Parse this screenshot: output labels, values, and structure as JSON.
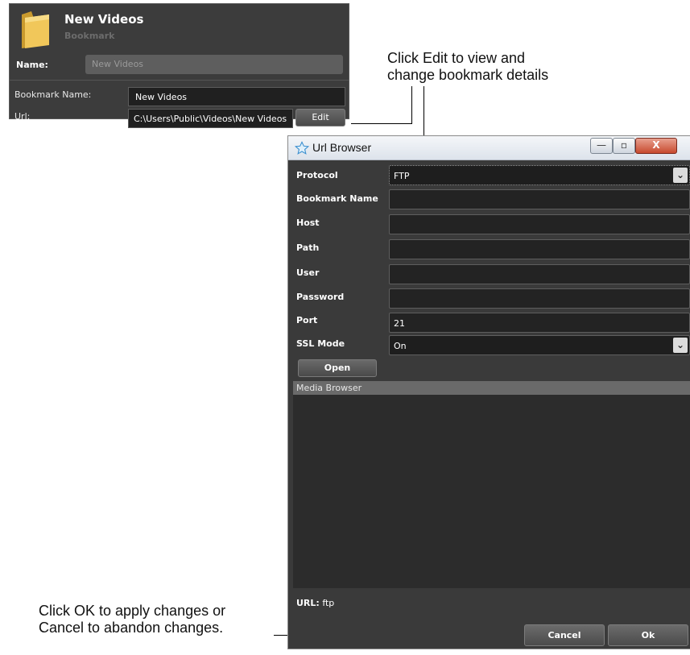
{
  "bookmark_panel": {
    "title": "New Videos",
    "subtitle": "Bookmark",
    "name_label": "Name:",
    "name_value": "New Videos",
    "bookmark_name_label": "Bookmark Name:",
    "bookmark_name_value": "New Videos",
    "url_label": "Url:",
    "url_value": "C:\\Users\\Public\\Videos\\New Videos",
    "edit_label": "Edit",
    "icon": "folder-icon"
  },
  "annotations": {
    "edit_note_line1": "Click Edit to view and",
    "edit_note_line2": "change bookmark details",
    "ok_note_line1": "Click OK to apply changes or",
    "ok_note_line2": "Cancel to abandon changes."
  },
  "url_browser": {
    "title": "Url Browser",
    "title_icon": "star-icon",
    "window_buttons": {
      "minimize": "—",
      "maximize": "▫",
      "close": "X"
    },
    "fields": {
      "protocol_label": "Protocol",
      "protocol_value": "FTP",
      "bookmark_name_label": "Bookmark Name",
      "bookmark_name_value": "",
      "host_label": "Host",
      "host_value": "",
      "path_label": "Path",
      "path_value": "",
      "user_label": "User",
      "user_value": "",
      "password_label": "Password",
      "password_value": "",
      "port_label": "Port",
      "port_value": "21",
      "ssl_label": "SSL Mode",
      "ssl_value": "On"
    },
    "open_label": "Open",
    "media_browser_label": "Media Browser",
    "url_label": "URL:",
    "url_value": "ftp",
    "cancel_label": "Cancel",
    "ok_label": "Ok"
  },
  "colors": {
    "panel_bg": "#3c3c3c",
    "field_bg": "#202020",
    "titlebar": "#e8ecf1",
    "close_red": "#c84a2e"
  }
}
